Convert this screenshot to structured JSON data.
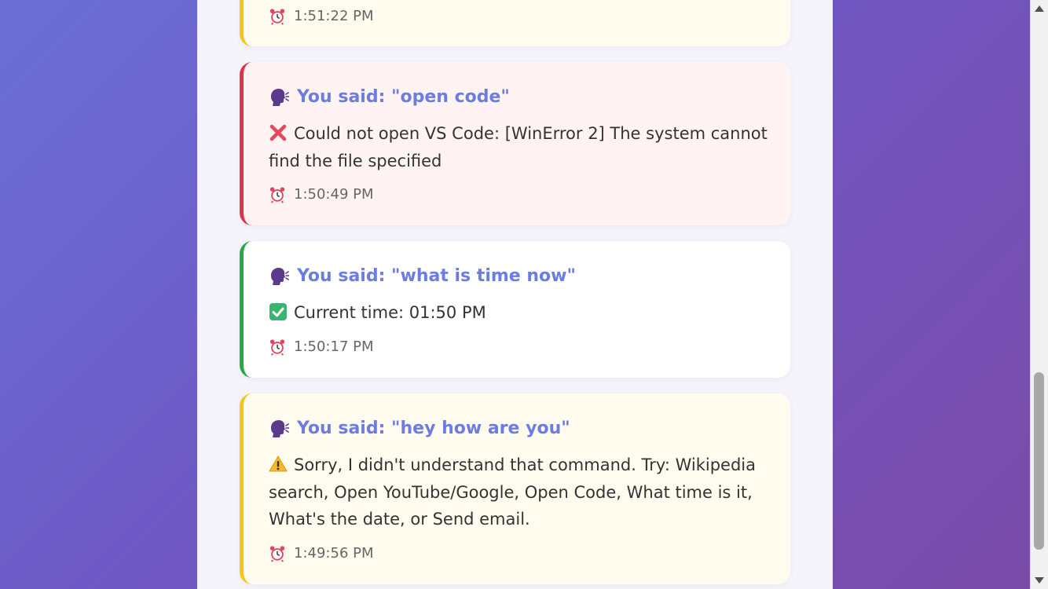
{
  "entries": [
    {
      "type": "warning",
      "time": "1:51:22 PM"
    },
    {
      "type": "error",
      "heading": "You said: \"open code\"",
      "status_icon": "cross-mark-icon",
      "message": "Could not open VS Code: [WinError 2] The system cannot find the file specified",
      "time": "1:50:49 PM"
    },
    {
      "type": "success",
      "heading": "You said: \"what is time now\"",
      "status_icon": "check-mark-icon",
      "message": "Current time: 01:50 PM",
      "time": "1:50:17 PM"
    },
    {
      "type": "warning",
      "heading": "You said: \"hey how are you\"",
      "status_icon": "warning-icon",
      "message": "Sorry, I didn't understand that command. Try: Wikipedia search, Open YouTube/Google, Open Code, What time is it, What's the date, or Send email.",
      "time": "1:49:56 PM"
    }
  ],
  "colors": {
    "heading": "#6b7ee0",
    "warning_border": "#f5c518",
    "error_border": "#dc3545",
    "success_border": "#28a745",
    "warning_bg": "#fffbef",
    "error_bg": "#fff3f3",
    "success_bg": "#ffffff"
  },
  "icons": {
    "speaker": "speaking-head-icon",
    "clock": "alarm-clock-icon"
  }
}
